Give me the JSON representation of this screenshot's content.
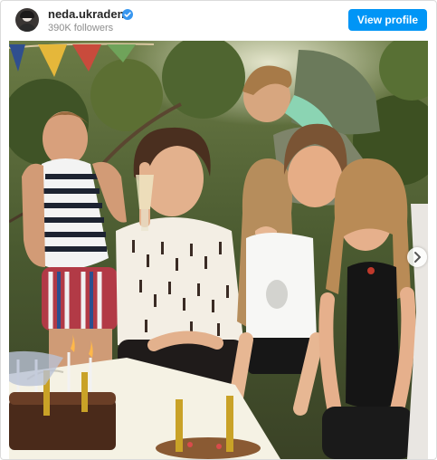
{
  "post": {
    "username": "neda.ukraden",
    "followers": "390K followers",
    "view_profile_label": "View profile",
    "verified_icon": "verified-badge-icon",
    "next_icon": "chevron-right-icon"
  },
  "colors": {
    "button_blue": "#0095f6",
    "verified_blue": "#3897f0",
    "username_text": "#262626",
    "secondary_text": "#8e8e8e"
  }
}
